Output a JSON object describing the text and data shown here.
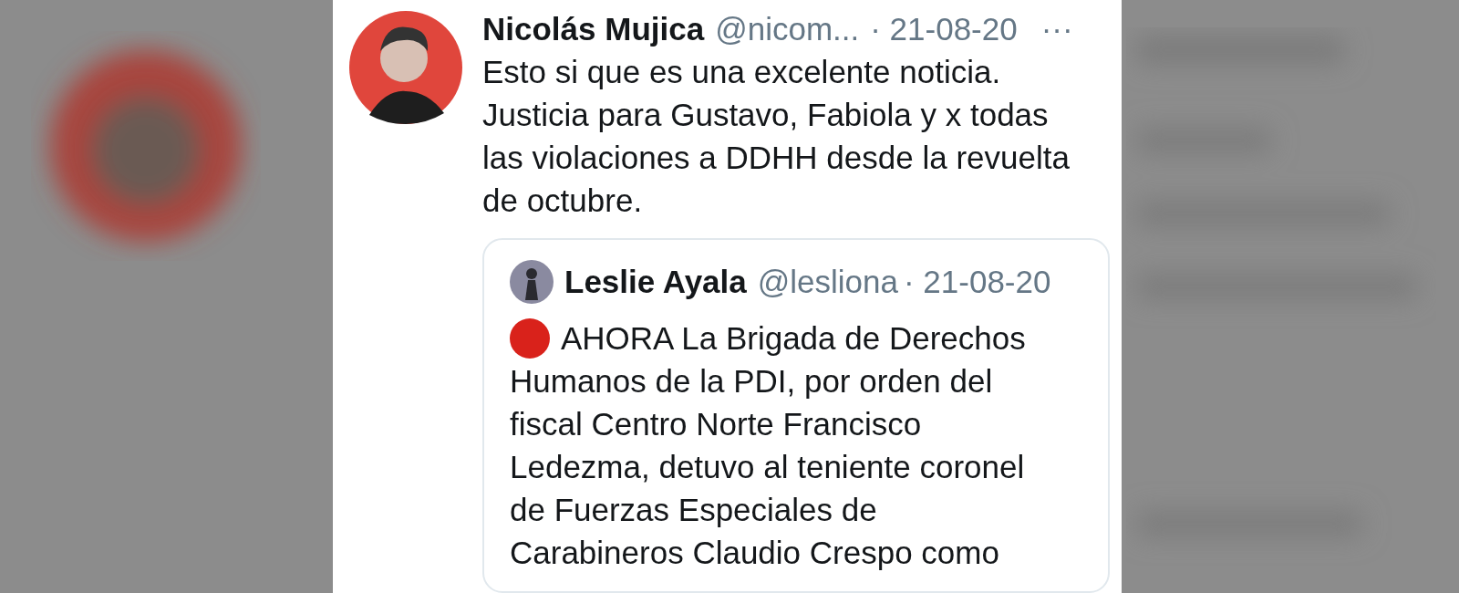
{
  "tweet": {
    "name": "Nicolás Mujica",
    "handle": "@nicom...",
    "date": "· 21-08-20",
    "more": "···",
    "lines": [
      "Esto si que es una excelente noticia.",
      "Justicia para Gustavo, Fabiola y x todas",
      "las violaciones a DDHH desde la revuelta",
      "de octubre."
    ],
    "quote": {
      "name": "Leslie Ayala",
      "handle": "@lesliona",
      "date": "· 21-08-20",
      "lines": [
        "AHORA La Brigada de Derechos",
        "Humanos de la PDI, por orden del",
        "fiscal Centro Norte Francisco",
        "Ledezma, detuvo al teniente coronel",
        "de Fuerzas Especiales de",
        "Carabineros Claudio Crespo como"
      ]
    }
  }
}
